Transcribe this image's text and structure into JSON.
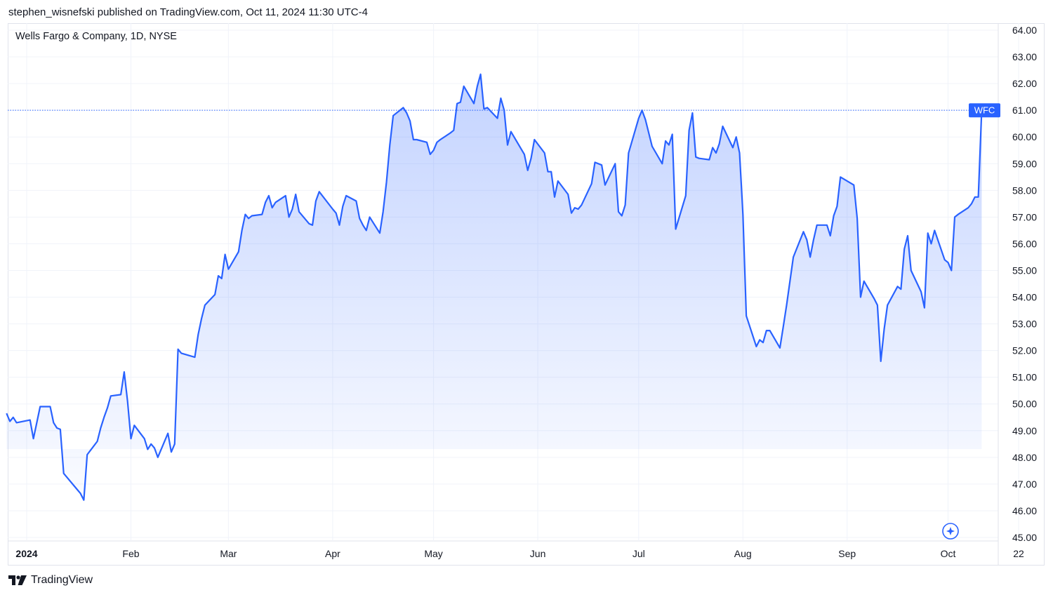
{
  "header": {
    "published_text": "stephen_wisnefski published on TradingView.com, Oct 11, 2024 11:30 UTC-4"
  },
  "footer": {
    "brand": "TradingView",
    "logo_icon": "tradingview-logo-icon"
  },
  "chart": {
    "symbol_title": "Wells Fargo & Company, 1D, NYSE",
    "price_badge": "WFC",
    "accent_color": "#2962ff"
  },
  "chart_data": {
    "type": "area",
    "title": "Wells Fargo & Company, 1D, NYSE",
    "ticker": "WFC",
    "ylim": [
      45.0,
      64.0
    ],
    "yticks": [
      "64.00",
      "63.00",
      "62.00",
      "61.00",
      "60.00",
      "59.00",
      "58.00",
      "57.00",
      "56.00",
      "55.00",
      "54.00",
      "53.00",
      "52.00",
      "51.00",
      "50.00",
      "49.00",
      "48.00",
      "47.00",
      "46.00",
      "45.00"
    ],
    "xticks": [
      {
        "label": "2024",
        "date": "2024-01-01",
        "bold": true
      },
      {
        "label": "Feb",
        "date": "2024-02-01",
        "bold": false
      },
      {
        "label": "Mar",
        "date": "2024-03-01",
        "bold": false
      },
      {
        "label": "Apr",
        "date": "2024-04-01",
        "bold": false
      },
      {
        "label": "May",
        "date": "2024-05-01",
        "bold": false
      },
      {
        "label": "Jun",
        "date": "2024-06-01",
        "bold": false
      },
      {
        "label": "Jul",
        "date": "2024-07-01",
        "bold": false
      },
      {
        "label": "Aug",
        "date": "2024-08-01",
        "bold": false
      },
      {
        "label": "Sep",
        "date": "2024-09-01",
        "bold": false
      },
      {
        "label": "Oct",
        "date": "2024-10-01",
        "bold": false
      },
      {
        "label": "22",
        "date": "2024-10-22",
        "bold": false
      }
    ],
    "grid": true,
    "last_value": 61.0,
    "series": [
      {
        "name": "WFC",
        "color": "#2962ff",
        "points": [
          [
            "2023-12-26",
            49.65
          ],
          [
            "2023-12-27",
            49.35
          ],
          [
            "2023-12-28",
            49.5
          ],
          [
            "2023-12-29",
            49.3
          ],
          [
            "2024-01-02",
            49.4
          ],
          [
            "2024-01-03",
            48.7
          ],
          [
            "2024-01-04",
            49.3
          ],
          [
            "2024-01-05",
            49.9
          ],
          [
            "2024-01-08",
            49.9
          ],
          [
            "2024-01-09",
            49.3
          ],
          [
            "2024-01-10",
            49.1
          ],
          [
            "2024-01-11",
            49.05
          ],
          [
            "2024-01-12",
            47.4
          ],
          [
            "2024-01-16",
            46.8
          ],
          [
            "2024-01-17",
            46.65
          ],
          [
            "2024-01-18",
            46.4
          ],
          [
            "2024-01-19",
            48.1
          ],
          [
            "2024-01-22",
            48.6
          ],
          [
            "2024-01-23",
            49.1
          ],
          [
            "2024-01-24",
            49.5
          ],
          [
            "2024-01-25",
            49.85
          ],
          [
            "2024-01-26",
            50.3
          ],
          [
            "2024-01-29",
            50.35
          ],
          [
            "2024-01-30",
            51.2
          ],
          [
            "2024-01-31",
            50.1
          ],
          [
            "2024-02-01",
            48.7
          ],
          [
            "2024-02-02",
            49.2
          ],
          [
            "2024-02-05",
            48.7
          ],
          [
            "2024-02-06",
            48.3
          ],
          [
            "2024-02-07",
            48.5
          ],
          [
            "2024-02-08",
            48.35
          ],
          [
            "2024-02-09",
            48.0
          ],
          [
            "2024-02-12",
            48.9
          ],
          [
            "2024-02-13",
            48.2
          ],
          [
            "2024-02-14",
            48.5
          ],
          [
            "2024-02-15",
            52.05
          ],
          [
            "2024-02-16",
            51.9
          ],
          [
            "2024-02-20",
            51.75
          ],
          [
            "2024-02-21",
            52.6
          ],
          [
            "2024-02-22",
            53.2
          ],
          [
            "2024-02-23",
            53.7
          ],
          [
            "2024-02-26",
            54.1
          ],
          [
            "2024-02-27",
            54.8
          ],
          [
            "2024-02-28",
            54.7
          ],
          [
            "2024-02-29",
            55.6
          ],
          [
            "2024-03-01",
            55.05
          ],
          [
            "2024-03-04",
            55.7
          ],
          [
            "2024-03-05",
            56.5
          ],
          [
            "2024-03-06",
            57.1
          ],
          [
            "2024-03-07",
            56.95
          ],
          [
            "2024-03-08",
            57.05
          ],
          [
            "2024-03-11",
            57.1
          ],
          [
            "2024-03-12",
            57.55
          ],
          [
            "2024-03-13",
            57.8
          ],
          [
            "2024-03-14",
            57.35
          ],
          [
            "2024-03-15",
            57.55
          ],
          [
            "2024-03-18",
            57.8
          ],
          [
            "2024-03-19",
            57.0
          ],
          [
            "2024-03-20",
            57.3
          ],
          [
            "2024-03-21",
            57.85
          ],
          [
            "2024-03-22",
            57.2
          ],
          [
            "2024-03-25",
            56.75
          ],
          [
            "2024-03-26",
            56.7
          ],
          [
            "2024-03-27",
            57.6
          ],
          [
            "2024-03-28",
            57.95
          ],
          [
            "2024-04-01",
            57.3
          ],
          [
            "2024-04-02",
            57.15
          ],
          [
            "2024-04-03",
            56.7
          ],
          [
            "2024-04-04",
            57.4
          ],
          [
            "2024-04-05",
            57.8
          ],
          [
            "2024-04-08",
            57.6
          ],
          [
            "2024-04-09",
            56.95
          ],
          [
            "2024-04-10",
            56.7
          ],
          [
            "2024-04-11",
            56.5
          ],
          [
            "2024-04-12",
            57.0
          ],
          [
            "2024-04-15",
            56.4
          ],
          [
            "2024-04-16",
            57.2
          ],
          [
            "2024-04-17",
            58.3
          ],
          [
            "2024-04-18",
            59.7
          ],
          [
            "2024-04-19",
            60.8
          ],
          [
            "2024-04-22",
            61.1
          ],
          [
            "2024-04-23",
            60.9
          ],
          [
            "2024-04-24",
            60.6
          ],
          [
            "2024-04-25",
            59.9
          ],
          [
            "2024-04-26",
            59.9
          ],
          [
            "2024-04-29",
            59.8
          ],
          [
            "2024-04-30",
            59.35
          ],
          [
            "2024-05-01",
            59.5
          ],
          [
            "2024-05-02",
            59.8
          ],
          [
            "2024-05-03",
            59.9
          ],
          [
            "2024-05-06",
            60.15
          ],
          [
            "2024-05-07",
            60.25
          ],
          [
            "2024-05-08",
            61.25
          ],
          [
            "2024-05-09",
            61.3
          ],
          [
            "2024-05-10",
            61.9
          ],
          [
            "2024-05-13",
            61.25
          ],
          [
            "2024-05-14",
            61.9
          ],
          [
            "2024-05-15",
            62.35
          ],
          [
            "2024-05-16",
            61.05
          ],
          [
            "2024-05-17",
            61.1
          ],
          [
            "2024-05-20",
            60.7
          ],
          [
            "2024-05-21",
            61.45
          ],
          [
            "2024-05-22",
            61.0
          ],
          [
            "2024-05-23",
            59.7
          ],
          [
            "2024-05-24",
            60.2
          ],
          [
            "2024-05-28",
            59.35
          ],
          [
            "2024-05-29",
            58.75
          ],
          [
            "2024-05-30",
            59.2
          ],
          [
            "2024-05-31",
            59.9
          ],
          [
            "2024-06-03",
            59.4
          ],
          [
            "2024-06-04",
            58.7
          ],
          [
            "2024-06-05",
            58.7
          ],
          [
            "2024-06-06",
            57.75
          ],
          [
            "2024-06-07",
            58.35
          ],
          [
            "2024-06-10",
            57.85
          ],
          [
            "2024-06-11",
            57.15
          ],
          [
            "2024-06-12",
            57.35
          ],
          [
            "2024-06-13",
            57.3
          ],
          [
            "2024-06-14",
            57.45
          ],
          [
            "2024-06-17",
            58.25
          ],
          [
            "2024-06-18",
            59.05
          ],
          [
            "2024-06-20",
            58.95
          ],
          [
            "2024-06-21",
            58.2
          ],
          [
            "2024-06-24",
            59.0
          ],
          [
            "2024-06-25",
            57.2
          ],
          [
            "2024-06-26",
            57.05
          ],
          [
            "2024-06-27",
            57.45
          ],
          [
            "2024-06-28",
            59.4
          ],
          [
            "2024-07-01",
            60.7
          ],
          [
            "2024-07-02",
            61.0
          ],
          [
            "2024-07-03",
            60.65
          ],
          [
            "2024-07-05",
            59.65
          ],
          [
            "2024-07-08",
            59.0
          ],
          [
            "2024-07-09",
            59.85
          ],
          [
            "2024-07-10",
            59.7
          ],
          [
            "2024-07-11",
            60.1
          ],
          [
            "2024-07-12",
            56.55
          ],
          [
            "2024-07-15",
            57.8
          ],
          [
            "2024-07-16",
            60.25
          ],
          [
            "2024-07-17",
            60.9
          ],
          [
            "2024-07-18",
            59.25
          ],
          [
            "2024-07-19",
            59.2
          ],
          [
            "2024-07-22",
            59.15
          ],
          [
            "2024-07-23",
            59.6
          ],
          [
            "2024-07-24",
            59.4
          ],
          [
            "2024-07-25",
            59.75
          ],
          [
            "2024-07-26",
            60.4
          ],
          [
            "2024-07-29",
            59.6
          ],
          [
            "2024-07-30",
            60.0
          ],
          [
            "2024-07-31",
            59.4
          ],
          [
            "2024-08-01",
            57.1
          ],
          [
            "2024-08-02",
            53.3
          ],
          [
            "2024-08-05",
            52.15
          ],
          [
            "2024-08-06",
            52.4
          ],
          [
            "2024-08-07",
            52.3
          ],
          [
            "2024-08-08",
            52.75
          ],
          [
            "2024-08-09",
            52.75
          ],
          [
            "2024-08-12",
            52.1
          ],
          [
            "2024-08-13",
            52.9
          ],
          [
            "2024-08-14",
            53.7
          ],
          [
            "2024-08-15",
            54.6
          ],
          [
            "2024-08-16",
            55.5
          ],
          [
            "2024-08-19",
            56.45
          ],
          [
            "2024-08-20",
            56.15
          ],
          [
            "2024-08-21",
            55.5
          ],
          [
            "2024-08-22",
            56.15
          ],
          [
            "2024-08-23",
            56.7
          ],
          [
            "2024-08-26",
            56.7
          ],
          [
            "2024-08-27",
            56.3
          ],
          [
            "2024-08-28",
            57.05
          ],
          [
            "2024-08-29",
            57.4
          ],
          [
            "2024-08-30",
            58.5
          ],
          [
            "2024-09-03",
            58.2
          ],
          [
            "2024-09-04",
            56.95
          ],
          [
            "2024-09-05",
            54.0
          ],
          [
            "2024-09-06",
            54.6
          ],
          [
            "2024-09-09",
            53.95
          ],
          [
            "2024-09-10",
            53.7
          ],
          [
            "2024-09-11",
            51.6
          ],
          [
            "2024-09-12",
            52.8
          ],
          [
            "2024-09-13",
            53.7
          ],
          [
            "2024-09-16",
            54.4
          ],
          [
            "2024-09-17",
            54.3
          ],
          [
            "2024-09-18",
            55.8
          ],
          [
            "2024-09-19",
            56.3
          ],
          [
            "2024-09-20",
            55.0
          ],
          [
            "2024-09-23",
            54.2
          ],
          [
            "2024-09-24",
            53.6
          ],
          [
            "2024-09-25",
            56.4
          ],
          [
            "2024-09-26",
            56.0
          ],
          [
            "2024-09-27",
            56.5
          ],
          [
            "2024-09-30",
            55.4
          ],
          [
            "2024-10-01",
            55.3
          ],
          [
            "2024-10-02",
            55.0
          ],
          [
            "2024-10-03",
            57.0
          ],
          [
            "2024-10-04",
            57.1
          ],
          [
            "2024-10-07",
            57.35
          ],
          [
            "2024-10-08",
            57.5
          ],
          [
            "2024-10-09",
            57.75
          ],
          [
            "2024-10-10",
            57.75
          ],
          [
            "2024-10-11",
            61.0
          ]
        ]
      }
    ]
  }
}
